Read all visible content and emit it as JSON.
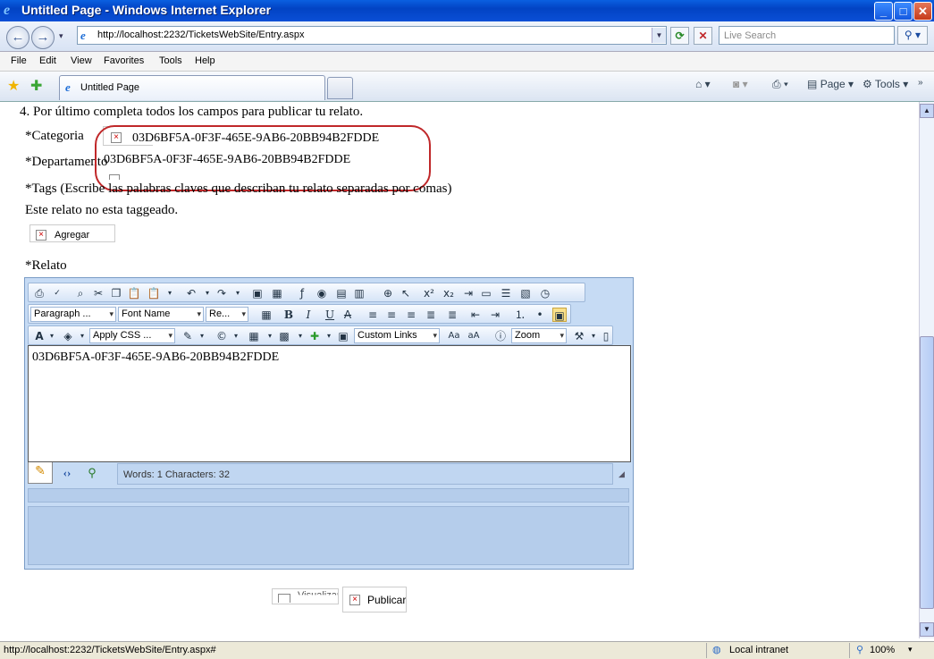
{
  "window": {
    "title": "Untitled Page - Windows Internet Explorer"
  },
  "addressbar": {
    "url": "http://localhost:2232/TicketsWebSite/Entry.aspx",
    "search_placeholder": "Live Search"
  },
  "menu": {
    "items": [
      "File",
      "Edit",
      "View",
      "Favorites",
      "Tools",
      "Help"
    ]
  },
  "tabs": {
    "active_label": "Untitled Page"
  },
  "command_bar": {
    "page_label": "Page",
    "tools_label": "Tools"
  },
  "page": {
    "step_text": "4. Por último completa todos los campos para publicar tu relato.",
    "categoria_label": "*Categoria",
    "categoria_value": "03D6BF5A-0F3F-465E-9AB6-20BB94B2FDDE",
    "departamento_label": "*Departamento",
    "departamento_value": "03D6BF5A-0F3F-465E-9AB6-20BB94B2FDDE",
    "tags_label": "*Tags (Escribe las palabras claves que describan tu relato separadas por comas)",
    "no_tags_text": "Este relato no esta taggeado.",
    "agregar_button": "Agregar",
    "relato_label": "*Relato",
    "publicar_button": "Publicar",
    "preview_button": "Visualizar"
  },
  "editor": {
    "paragraph_dropdown": "Paragraph ...",
    "font_name_dropdown": "Font Name",
    "font_size_dropdown": "Re...",
    "apply_css_dropdown": "Apply CSS ...",
    "custom_links_dropdown": "Custom Links",
    "zoom_dropdown": "Zoom",
    "content": "03D6BF5A-0F3F-465E-9AB6-20BB94B2FDDE",
    "word_count": "Words: 1 Characters: 32"
  },
  "statusbar": {
    "url": "http://localhost:2232/TicketsWebSite/Entry.aspx#",
    "zone": "Local intranet",
    "zoom": "100%"
  }
}
